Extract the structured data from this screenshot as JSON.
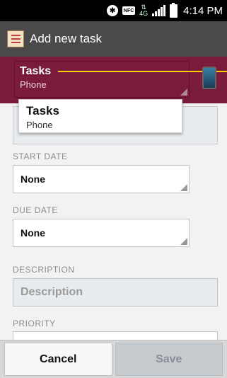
{
  "status_bar": {
    "bluetooth_icon": "bluetooth-icon",
    "nfc_label": "NFC",
    "network_label": "4G",
    "signal_icon": "signal-icon",
    "battery_icon": "battery-icon",
    "time": "4:14 PM"
  },
  "action_bar": {
    "icon": "task-list-icon",
    "title": "Add new task"
  },
  "account": {
    "name": "Tasks",
    "type": "Phone",
    "device_icon": "phone-icon",
    "accent_color": "#7a1a3c"
  },
  "dropdown": {
    "items": [
      {
        "name": "Tasks",
        "type": "Phone"
      }
    ]
  },
  "form": {
    "start_date_label": "START DATE",
    "start_date_value": "None",
    "due_date_label": "DUE DATE",
    "due_date_value": "None",
    "description_label": "DESCRIPTION",
    "description_placeholder": "Description",
    "priority_label": "PRIORITY"
  },
  "buttons": {
    "cancel": "Cancel",
    "save": "Save"
  }
}
